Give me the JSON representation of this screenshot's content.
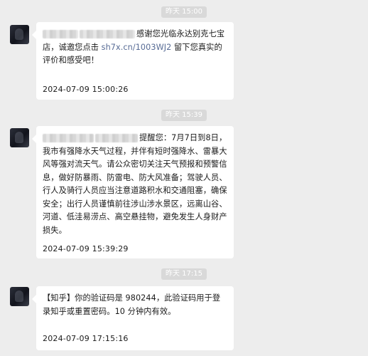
{
  "chat": {
    "separators": [
      {
        "label": "昨天 15:00"
      },
      {
        "label": "昨天 15:39"
      },
      {
        "label": "昨天 17:15"
      }
    ],
    "messages": [
      {
        "before_link": "感谢您光临永达别克七宝店，诚邀您点击 ",
        "link": "sh7x.cn/1003WJ2",
        "after_link": " 留下您真实的评价和感受吧！",
        "timestamp": "2024-07-09 15:00:26"
      },
      {
        "text": "提醒您：7月7日到8日，我市有强降水天气过程，并伴有短时强降水、雷暴大风等强对流天气。请公众密切关注天气预报和预警信息，做好防暴雨、防雷电、防大风准备；驾驶人员、行人及骑行人员应当注意道路积水和交通阻塞，确保安全；出行人员谨慎前往涉山涉水景区，远离山谷、河道、低洼易涝点、高空悬挂物，避免发生人身财产损失。",
        "timestamp": "2024-07-09 15:39:29"
      },
      {
        "text": "【知乎】你的验证码是 980244，此验证码用于登录知乎或重置密码。10 分钟内有效。",
        "timestamp": "2024-07-09 17:15:16"
      }
    ]
  }
}
